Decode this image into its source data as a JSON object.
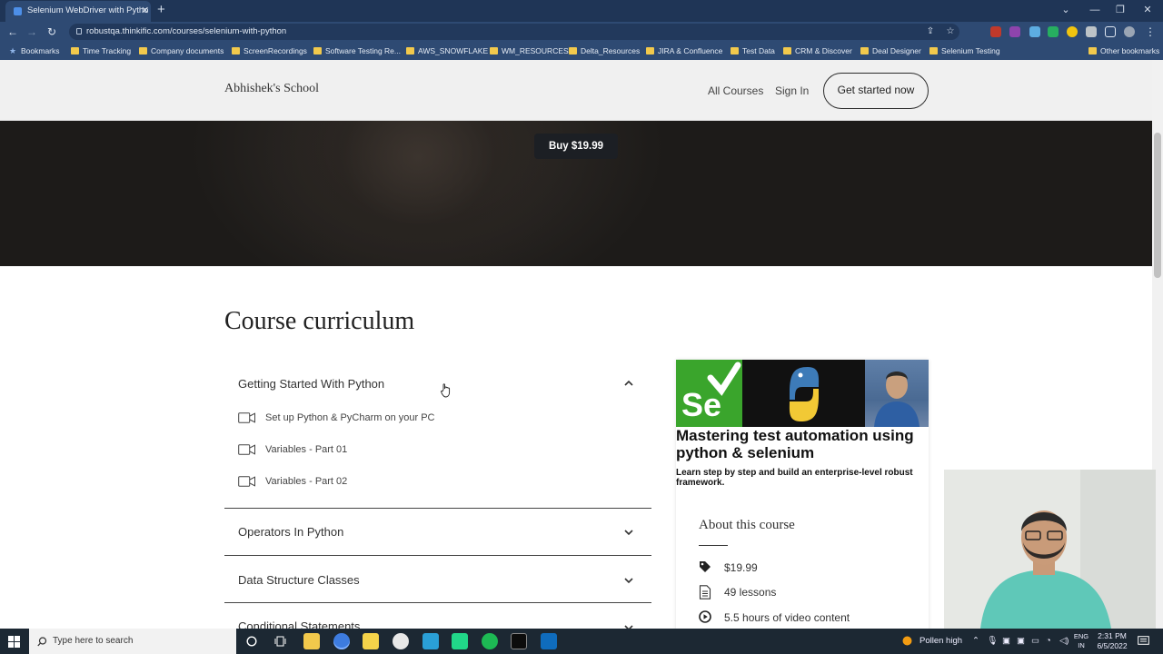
{
  "browser": {
    "tab_title": "Selenium WebDriver with Pytho",
    "url": "robustqa.thinkific.com/courses/selenium-with-python",
    "bookmarks": [
      "Bookmarks",
      "Time Tracking",
      "Company documents",
      "ScreenRecordings",
      "Software Testing Re...",
      "AWS_SNOWFLAKE",
      "WM_RESOURCES",
      "Delta_Resources",
      "JIRA & Confluence",
      "Test Data",
      "CRM & Discover",
      "Deal Designer",
      "Selenium Testing",
      "Other bookmarks"
    ]
  },
  "site": {
    "school_name": "Abhishek's School",
    "nav": {
      "all_courses": "All Courses",
      "sign_in": "Sign In",
      "cta": "Get started now"
    },
    "buy_label": "Buy $19.99"
  },
  "curriculum": {
    "title": "Course curriculum",
    "sections": [
      {
        "title": "Getting Started With Python",
        "lessons": [
          "Set up Python & PyCharm on your PC",
          "Variables - Part 01",
          "Variables - Part 02"
        ]
      },
      {
        "title": "Operators In Python"
      },
      {
        "title": "Data Structure Classes"
      },
      {
        "title": "Conditional Statements"
      }
    ]
  },
  "course_card": {
    "thumb_logo_text": "Se",
    "headline": "Mastering test automation using python & selenium",
    "subheadline": "Learn step by step and build an enterprise-level robust framework.",
    "about_title": "About this course",
    "price": "$19.99",
    "lessons": "49 lessons",
    "video": "5.5 hours of video content"
  },
  "taskbar": {
    "search_placeholder": "Type here to search",
    "weather": "Pollen high",
    "lang_top": "ENG",
    "lang_bottom": "IN",
    "time": "2:31 PM",
    "date": "6/5/2022"
  },
  "colors": {
    "chrome_dark": "#1f3556",
    "chrome": "#2e4a73",
    "selenium_green": "#3aa52c",
    "taskbar": "#1c2833"
  }
}
